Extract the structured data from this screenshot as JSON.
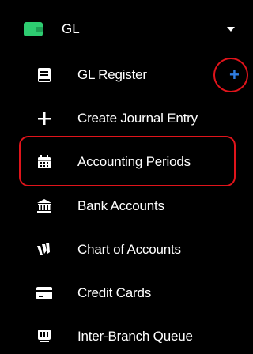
{
  "section": {
    "title": "GL",
    "icon": "wallet-icon",
    "color": "#2ecc71",
    "expanded": true
  },
  "items": [
    {
      "label": "GL Register",
      "icon": "book-icon"
    },
    {
      "label": "Create Journal Entry",
      "icon": "plus-icon"
    },
    {
      "label": "Accounting Periods",
      "icon": "calendar-icon"
    },
    {
      "label": "Bank Accounts",
      "icon": "bank-icon"
    },
    {
      "label": "Chart of Accounts",
      "icon": "chart-icon"
    },
    {
      "label": "Credit Cards",
      "icon": "credit-card-icon"
    },
    {
      "label": "Inter-Branch Queue",
      "icon": "queue-icon"
    }
  ],
  "gl_register_add": {
    "icon": "plus-icon",
    "color": "#2f7de1"
  },
  "annotations": {
    "color": "#e0141b"
  }
}
